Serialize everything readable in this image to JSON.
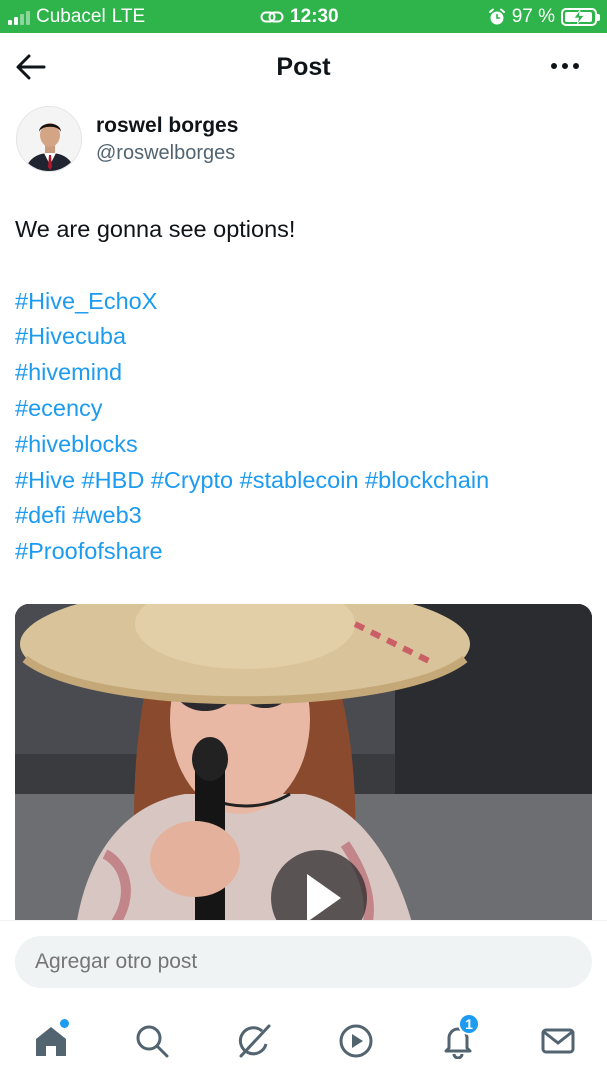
{
  "status_bar": {
    "carrier": "Cubacel",
    "network": "LTE",
    "time": "12:30",
    "battery_percent": "97 %",
    "battery_level": 0.97,
    "bg_color": "#2fb44b"
  },
  "header": {
    "title": "Post",
    "back_icon": "back-arrow-icon",
    "more_icon": "more-options-icon"
  },
  "post": {
    "author_name": "roswel borges",
    "author_handle": "@roswelborges",
    "text": "We are gonna see options!",
    "hashtag_lines": [
      "#Hive_EchoX",
      "#Hivecuba",
      "#hivemind",
      "#ecency",
      "#hiveblocks",
      "#Hive #HBD #Crypto #stablecoin #blockchain",
      "#defi #web3",
      "#Proofofshare"
    ],
    "media_type": "video",
    "media_icon": "play-icon"
  },
  "reply": {
    "placeholder": "Agregar otro post"
  },
  "tabbar": {
    "items": [
      "home-icon",
      "search-icon",
      "grok-icon",
      "video-icon",
      "notifications-icon",
      "messages-icon"
    ],
    "notifications_badge": "1"
  },
  "colors": {
    "accent": "#1d9bf0",
    "text": "#0f1419",
    "secondary_text": "#536471"
  }
}
